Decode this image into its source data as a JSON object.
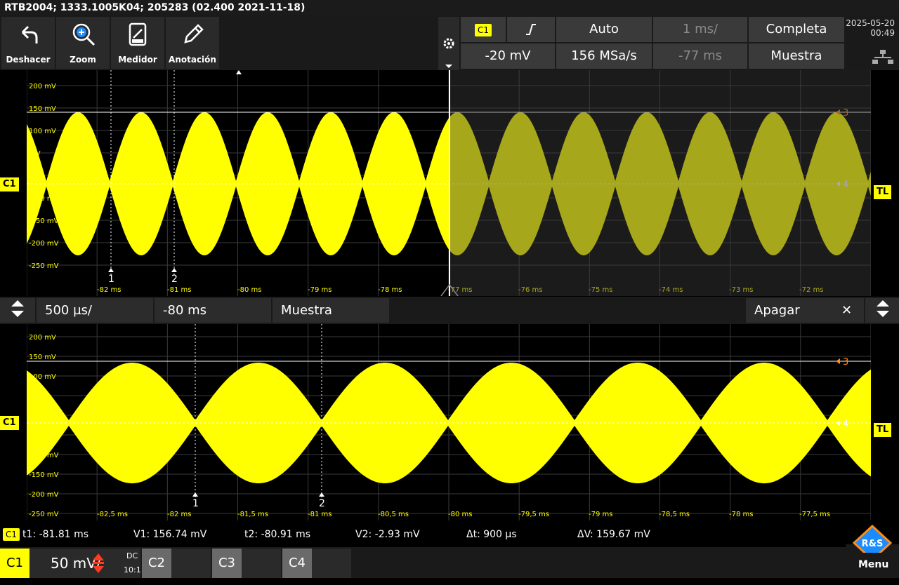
{
  "title": "RTB2004; 1333.1005K04; 205283 (02.400 2021-11-18)",
  "toolbar": {
    "undo": "Deshacer",
    "zoom": "Zoom",
    "meter": "Medidor",
    "annot": "Anotación"
  },
  "settings": {
    "trigger_src": "C1",
    "trigger_mode": "Auto",
    "timebase": "1 ms/",
    "acq": "Completa",
    "trigger_level": "-20 mV",
    "sample_rate": "156 MSa/s",
    "offset": "-77 ms",
    "mode": "Muestra",
    "date": "2025-05-20",
    "time": "00:49"
  },
  "top_plot": {
    "y_labels": [
      "200 mV",
      "150 mV",
      "100 mV",
      "mV",
      "-50",
      "-100 mV",
      "-150 mV",
      "-200 mV",
      "-250 mV"
    ],
    "x_labels": [
      "-82 ms",
      "-81 ms",
      "-80 ms",
      "-79 ms",
      "-78 ms",
      "-77 ms",
      "-76 ms",
      "-75 ms",
      "-74 ms",
      "-73 ms",
      "-72 ms"
    ],
    "cursor1": "1",
    "cursor2": "2",
    "marker3": "3",
    "marker4": "4"
  },
  "zoom_bar": {
    "timebase": "500 µs/",
    "position": "-80 ms",
    "mode": "Muestra",
    "off": "Apagar Zoom",
    "close": "✕"
  },
  "bottom_plot": {
    "y_labels": [
      "200 mV",
      "150 mV",
      "100 mV",
      "",
      "0 V",
      "",
      "-100 mV",
      "-150 mV",
      "-200 mV",
      "-250 mV"
    ],
    "x_labels": [
      "-82,5 ms",
      "-82 ms",
      "-81,5 ms",
      "-81 ms",
      "-80,5 ms",
      "-80 ms",
      "-79,5 ms",
      "-79 ms",
      "-78,5 ms",
      "-78 ms",
      "-77,5 ms"
    ],
    "cursor1": "1",
    "cursor2": "2",
    "marker3": "3",
    "marker4": "4"
  },
  "channel_flags": {
    "c1": "C1",
    "tl": "TL"
  },
  "measurements": {
    "tag": "C1",
    "t1": "t1: -81.81 ms",
    "v1": "V1: 156.74 mV",
    "t2": "t2: -80.91 ms",
    "v2": "V2: -2.93 mV",
    "dt": "Δt: 900 µs",
    "dv": "ΔV: 159.67 mV"
  },
  "channels": {
    "c1": "C1",
    "c1_scale": "50 mV/",
    "c1_coupling": "DC",
    "c1_probe": "10:1",
    "c2": "C2",
    "c3": "C3",
    "c4": "C4",
    "menu": "Menu",
    "logo": "R&S"
  },
  "colors": {
    "trace": "#ffff00",
    "marker": "#ff8c1a"
  }
}
